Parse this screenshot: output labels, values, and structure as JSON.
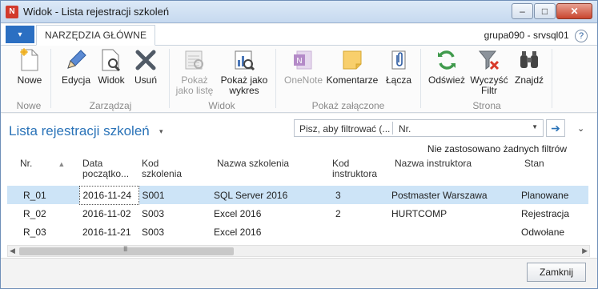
{
  "window": {
    "title": "Widok - Lista rejestracji szkoleń",
    "minimize": "–",
    "maximize": "□",
    "close": "✕"
  },
  "ribbon": {
    "app_menu": "▾",
    "tab": "NARZĘDZIA GŁÓWNE",
    "server": "grupa090 - srvsql01",
    "help": "?",
    "buttons": {
      "nowe": "Nowe",
      "edycja": "Edycja",
      "widok": "Widok",
      "usun": "Usuń",
      "pokaz_liste": "Pokaż\njako listę",
      "pokaz_wykres": "Pokaż jako\nwykres",
      "onenote": "OneNote",
      "komentarze": "Komentarze",
      "lacza": "Łącza",
      "odswiez": "Odśwież",
      "wyczysc_filtr": "Wyczyść\nFiltr",
      "znajdz": "Znajdź"
    },
    "groups": {
      "nowe": "Nowe",
      "zarzadzaj": "Zarządzaj",
      "widok": "Widok",
      "pokaz_zalaczone": "Pokaż załączone",
      "strona": "Strona"
    }
  },
  "list": {
    "title": "Lista rejestracji szkoleń",
    "title_arrow": "▾",
    "filter_placeholder": "Pisz, aby filtrować (...",
    "filter_field": "Nr.",
    "filter_dropdown": "▼",
    "filter_go": "➔",
    "collapse": "⌄",
    "no_filters": "Nie zastosowano żadnych filtrów",
    "columns": {
      "nr": "Nr.",
      "data": "Data\npoczątko...",
      "kod_szkolenia": "Kod\nszkolenia",
      "nazwa_szkolenia": "Nazwa szkolenia",
      "kod_instruktora": "Kod\ninstruktora",
      "nazwa_instruktora": "Nazwa instruktora",
      "stan": "Stan"
    },
    "sort_indicator": "▲",
    "rows": [
      {
        "nr": "R_01",
        "data": "2016-11-24",
        "kod_szkolenia": "S001",
        "nazwa_szkolenia": "SQL Server 2016",
        "kod_instruktora": "3",
        "nazwa_instruktora": "Postmaster Warszawa",
        "stan": "Planowane"
      },
      {
        "nr": "R_02",
        "data": "2016-11-02",
        "kod_szkolenia": "S003",
        "nazwa_szkolenia": "Excel 2016",
        "kod_instruktora": "2",
        "nazwa_instruktora": "HURTCOMP",
        "stan": "Rejestracja"
      },
      {
        "nr": "R_03",
        "data": "2016-11-21",
        "kod_szkolenia": "S003",
        "nazwa_szkolenia": "Excel 2016",
        "kod_instruktora": "",
        "nazwa_instruktora": "",
        "stan": "Odwołane"
      }
    ]
  },
  "scrollbar": {
    "left": "◀",
    "right": "▶",
    "grip": "III"
  },
  "footer": {
    "close_button": "Zamknij"
  },
  "colors": {
    "accent": "#2a73b8",
    "selected_row": "#cde4f7",
    "app_button": "#2b6fc2"
  }
}
